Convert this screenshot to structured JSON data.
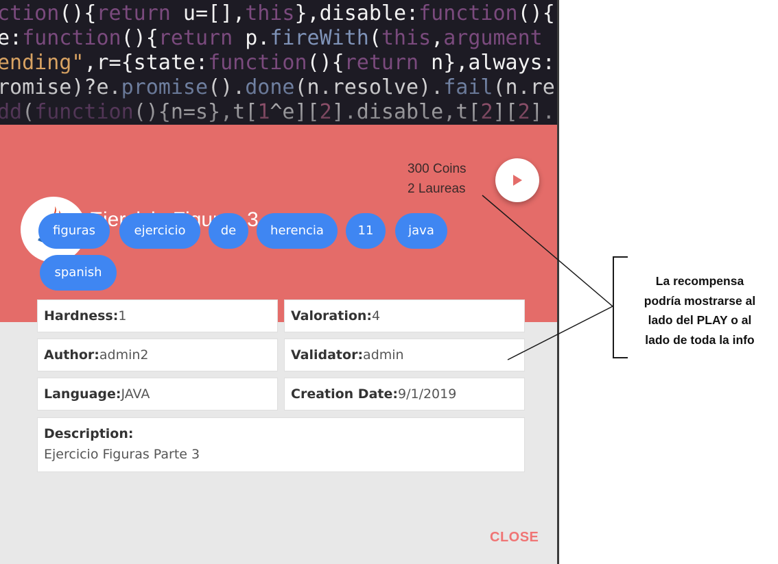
{
  "code_lines": [
    [
      "ction(){return u=[],this},disable:function(){"
    ],
    [
      "e:function(){return p.fireWith(this,argument"
    ],
    [
      "ending\",r={state:function(){return n},always:"
    ],
    [
      "romise)?e.promise().done(n.resolve).fail(n.re"
    ],
    [
      "dd(function(){n=s},t[1^e][2].disable,t[2][2]."
    ]
  ],
  "reward": {
    "coins": "300 Coins",
    "laureas": "2 Laureas"
  },
  "title": "Ejercicio Figuras 3",
  "tags": [
    "figuras",
    "ejercicio",
    "de",
    "herencia",
    "11",
    "java",
    "spanish"
  ],
  "fields": {
    "hardness_label": "Hardness:",
    "hardness_value": "1",
    "valoration_label": "Valoration:",
    "valoration_value": "4",
    "author_label": "Author:",
    "author_value": "admin2",
    "validator_label": "Validator:",
    "validator_value": "admin",
    "language_label": "Language:",
    "language_value": "JAVA",
    "creation_label": "Creation Date:",
    "creation_value": "9/1/2019",
    "description_label": "Description:",
    "description_value": "Ejercicio Figuras Parte 3"
  },
  "close_label": "CLOSE",
  "annotation": {
    "lines": [
      "La recompensa",
      "podría mostrarse al",
      "lado del PLAY o al",
      "lado de toda la info"
    ]
  },
  "icons": {
    "play": "play-icon",
    "logo": "java-logo-icon"
  },
  "colors": {
    "header": "#e46c69",
    "chip": "#3f86f2",
    "close": "#f07575"
  }
}
